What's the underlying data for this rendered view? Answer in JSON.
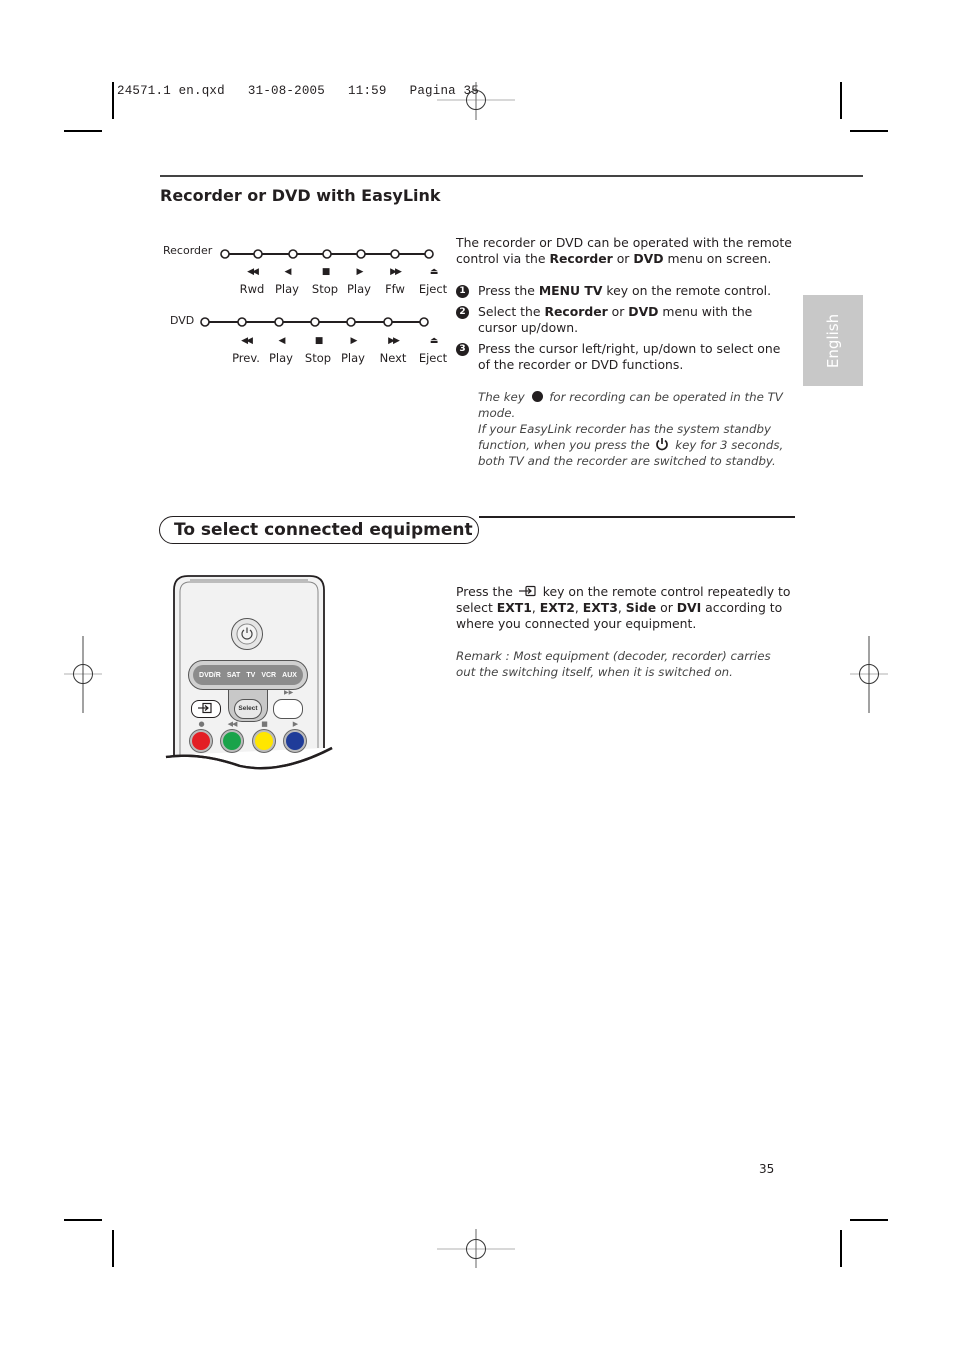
{
  "slug": {
    "text": "24571.1 en.qxd   31-08-2005   11:59   Pagina 35"
  },
  "side_tab": {
    "label": "English",
    "color": "#c8c8c8"
  },
  "section1": {
    "title": "Recorder or DVD with EasyLink",
    "diagram": {
      "recorder": {
        "label": "Recorder",
        "functions": [
          {
            "icon": "rewind-icon",
            "glyph": "◀◀",
            "label": "Rwd"
          },
          {
            "icon": "play-back-icon",
            "glyph": "◀",
            "label": "Play"
          },
          {
            "icon": "stop-icon",
            "glyph": "■",
            "label": "Stop"
          },
          {
            "icon": "play-icon",
            "glyph": "▶",
            "label": "Play"
          },
          {
            "icon": "fast-forward-icon",
            "glyph": "▶▶",
            "label": "Ffw"
          },
          {
            "icon": "eject-icon",
            "glyph": "⏏",
            "label": "Eject"
          }
        ]
      },
      "dvd": {
        "label": "DVD",
        "functions": [
          {
            "icon": "previous-icon",
            "glyph": "◀◀",
            "label": "Prev."
          },
          {
            "icon": "play-back-icon",
            "glyph": "◀",
            "label": "Play"
          },
          {
            "icon": "stop-icon",
            "glyph": "■",
            "label": "Stop"
          },
          {
            "icon": "play-icon",
            "glyph": "▶",
            "label": "Play"
          },
          {
            "icon": "next-icon",
            "glyph": "▶▶",
            "label": "Next"
          },
          {
            "icon": "eject-icon",
            "glyph": "⏏",
            "label": "Eject"
          }
        ]
      }
    },
    "intro": {
      "part1": "The recorder or DVD can be operated with the remote control via the ",
      "bold1": "Recorder",
      "part2": " or ",
      "bold2": "DVD",
      "part3": " menu on screen."
    },
    "steps": [
      {
        "num": "1",
        "pre": "Press the ",
        "bold": "MENU TV",
        "mid": " key on the remote control.",
        "bold2": "",
        "post": ""
      },
      {
        "num": "2",
        "pre": "Select the ",
        "bold": "Recorder",
        "mid": " or ",
        "bold2": "DVD",
        "post": " menu with the cursor up/down."
      },
      {
        "num": "3",
        "pre": "Press the cursor left/right, up/down to select one of the recorder or DVD functions.",
        "bold": "",
        "mid": "",
        "bold2": "",
        "post": ""
      }
    ],
    "note": {
      "line1_pre": "The key ",
      "line1_post": " for recording can be operated in the TV mode.",
      "line2_pre": "If your EasyLink recorder has the system standby function, when you press the ",
      "line2_post": " key for 3 seconds, both TV and the recorder are switched to standby."
    }
  },
  "section2": {
    "title": "To select connected equipment",
    "para": {
      "pre": "Press the ",
      "mid": " key on the remote control repeatedly to select ",
      "opt1": "EXT1",
      "sep1": ", ",
      "opt2": "EXT2",
      "sep2": ", ",
      "opt3": "EXT3",
      "sep3": ", ",
      "opt4": "Side",
      "sep4": " or ",
      "opt5": "DVI",
      "post": " according to where you connected your equipment."
    },
    "remark": "Remark : Most equipment (decoder, recorder) carries out the switching itself, when it is switched on.",
    "remote": {
      "source_buttons": [
        "DVD/R",
        "SAT",
        "TV",
        "VCR",
        "AUX"
      ],
      "select_label": "Select",
      "color_keys": [
        {
          "name": "red",
          "color": "#e31e24",
          "symbol": "●"
        },
        {
          "name": "green",
          "color": "#1aa34a",
          "symbol": "◀◀"
        },
        {
          "name": "yellow",
          "color": "#ffe600",
          "symbol": "■"
        },
        {
          "name": "blue",
          "color": "#1f3c99",
          "symbol": "▶"
        }
      ],
      "ffw_symbol": "▶▶"
    }
  },
  "page_number": "35"
}
